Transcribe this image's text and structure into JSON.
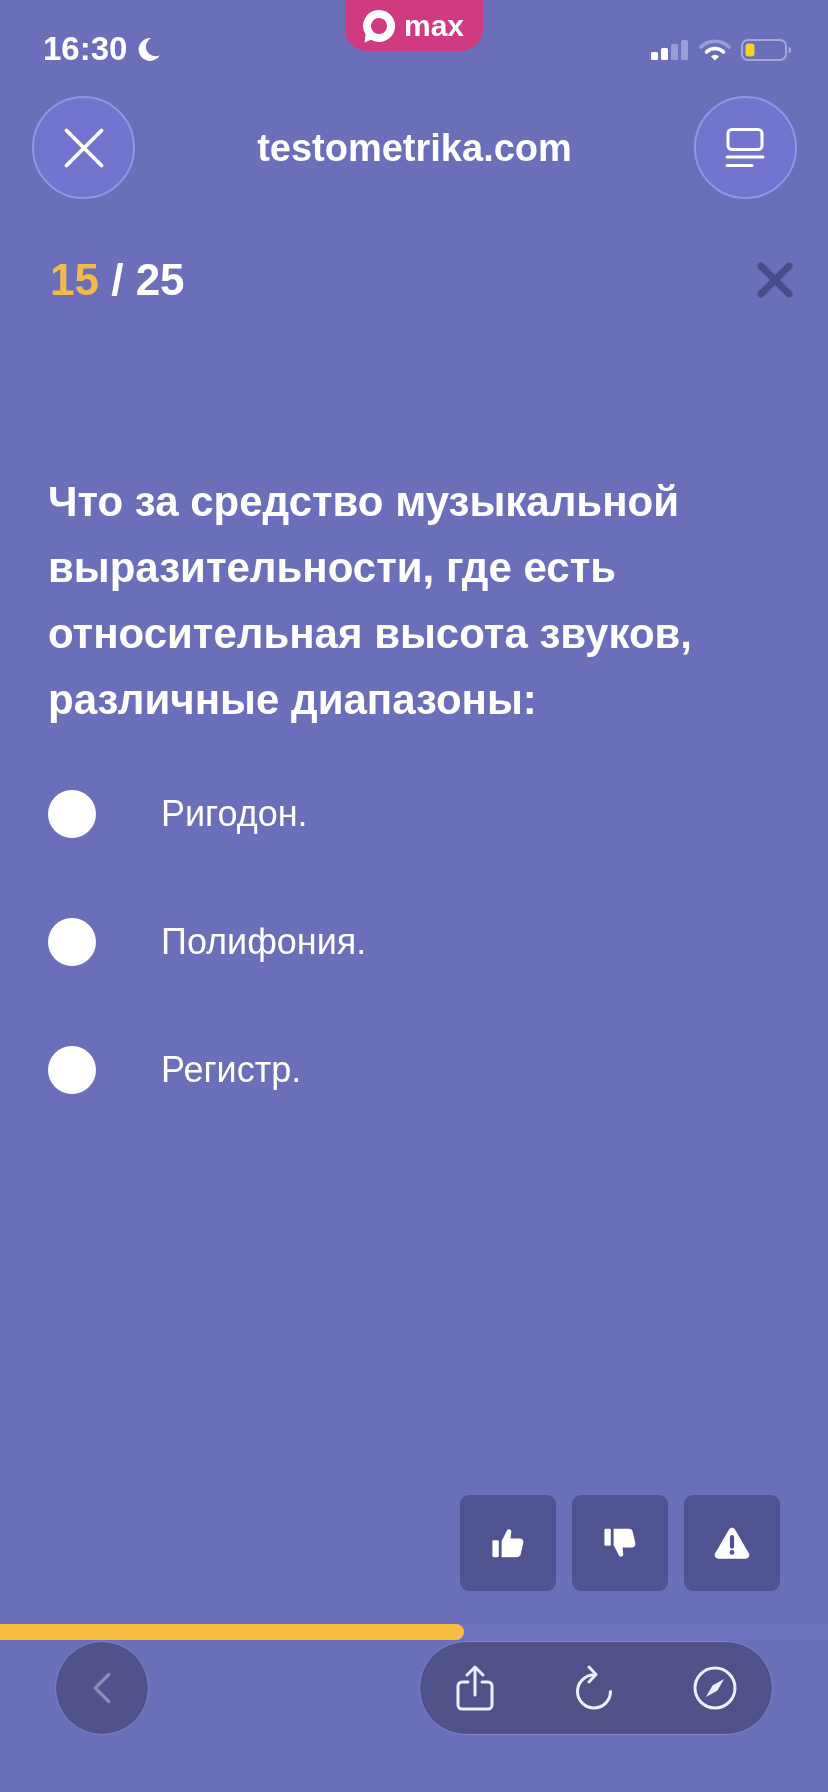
{
  "status_bar": {
    "time": "16:30",
    "app_badge": "max"
  },
  "header": {
    "title": "testometrika.com"
  },
  "counter": {
    "current": "15",
    "separator": "/",
    "total": "25"
  },
  "question": {
    "text": "Что за средство музыкальной выразительности, где есть относительная высота звуков, различные диапазоны:",
    "options": [
      {
        "label": "Ригодон.",
        "selected": false
      },
      {
        "label": "Полифония.",
        "selected": false
      },
      {
        "label": "Регистр.",
        "selected": false
      }
    ]
  },
  "progress": {
    "level": 0.56
  },
  "browser_toolbar": {
    "back": {
      "disabled": true
    }
  }
}
